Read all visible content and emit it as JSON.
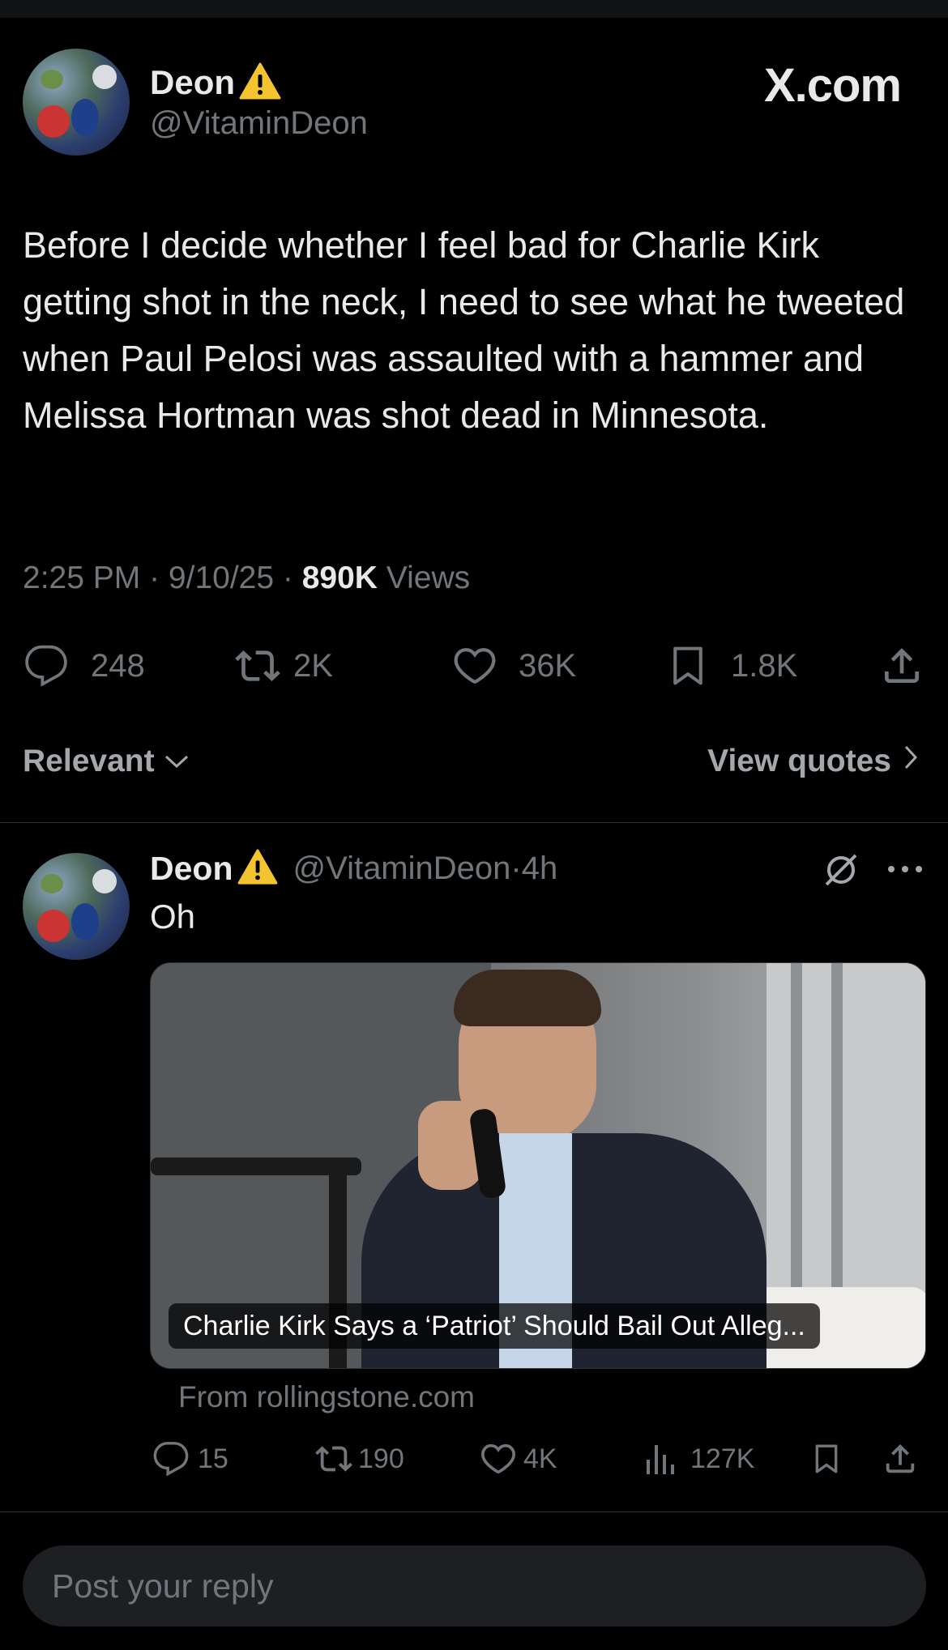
{
  "brand": {
    "logo_text": "X.com"
  },
  "main_post": {
    "author_name": "Deon",
    "author_handle": "@VitaminDeon",
    "text": "Before I decide whether I feel bad for Charlie Kirk getting shot in the neck, I need to see what he tweeted when Paul Pelosi was assaulted with a hammer and Melissa Hortman was shot dead in Minnesota.",
    "time": "2:25 PM",
    "date": "9/10/25",
    "views_count": "890K",
    "views_label": "Views",
    "replies": "248",
    "reposts": "2K",
    "likes": "36K",
    "bookmarks": "1.8K"
  },
  "sort": {
    "relevant_label": "Relevant",
    "view_quotes_label": "View quotes"
  },
  "reply_post": {
    "author_name": "Deon",
    "author_handle": "@VitaminDeon",
    "age": "4h",
    "text": "Oh",
    "card_caption": "Charlie Kirk Says a ‘Patriot’ Should Bail Out Alleg...",
    "card_source": "From rollingstone.com",
    "replies": "15",
    "reposts": "190",
    "likes": "4K",
    "views": "127K"
  },
  "composer": {
    "placeholder": "Post your reply"
  },
  "icons": {
    "warning": "warning-icon",
    "reply": "reply-icon",
    "repost": "repost-icon",
    "like": "heart-icon",
    "bookmark": "bookmark-icon",
    "share": "share-icon",
    "views": "views-icon",
    "grok": "grok-icon",
    "more": "more-icon"
  },
  "colors": {
    "background": "#000000",
    "text": "#e7e9ea",
    "muted": "#71767b",
    "divider": "#2f3336",
    "warning": "#f4c430"
  }
}
